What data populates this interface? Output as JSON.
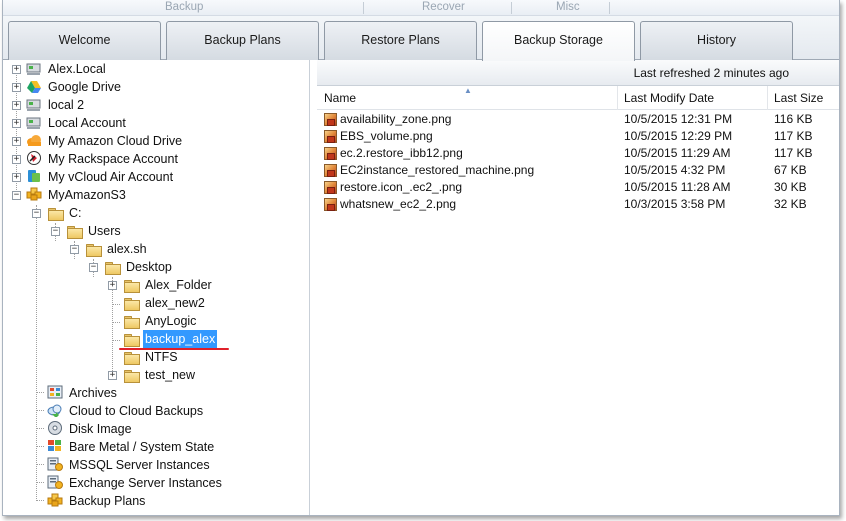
{
  "ribbon": {
    "items": [
      "Backup",
      "Recover",
      "Misc"
    ]
  },
  "tabs": [
    {
      "label": "Welcome",
      "active": false
    },
    {
      "label": "Backup Plans",
      "active": false
    },
    {
      "label": "Restore Plans",
      "active": false
    },
    {
      "label": "Backup Storage",
      "active": true
    },
    {
      "label": "History",
      "active": false
    }
  ],
  "tree": {
    "accounts": [
      {
        "label": "Alex.Local",
        "icon": "local-drive-icon"
      },
      {
        "label": "Google Drive",
        "icon": "google-drive-icon"
      },
      {
        "label": "local 2",
        "icon": "local-drive-icon"
      },
      {
        "label": "Local Account",
        "icon": "local-drive-icon"
      },
      {
        "label": "My Amazon Cloud Drive",
        "icon": "amazon-cloud-drive-icon"
      },
      {
        "label": "My Rackspace Account",
        "icon": "rackspace-icon"
      },
      {
        "label": "My vCloud Air Account",
        "icon": "vcloud-air-icon"
      },
      {
        "label": "MyAmazonS3",
        "icon": "amazon-s3-icon"
      }
    ],
    "folders": {
      "c": "C:",
      "users": "Users",
      "alex_sh": "alex.sh",
      "desktop": "Desktop",
      "children": [
        "Alex_Folder",
        "alex_new2",
        "AnyLogic",
        "backup_alex",
        "NTFS",
        "test_new"
      ],
      "selected": "backup_alex"
    },
    "categories": [
      {
        "label": "Archives",
        "icon": "archives-icon"
      },
      {
        "label": "Cloud to Cloud Backups",
        "icon": "cloud-to-cloud-icon"
      },
      {
        "label": "Disk Image",
        "icon": "disk-image-icon"
      },
      {
        "label": "Bare Metal / System State",
        "icon": "bare-metal-icon"
      },
      {
        "label": "MSSQL Server Instances",
        "icon": "mssql-icon"
      },
      {
        "label": "Exchange Server Instances",
        "icon": "exchange-icon"
      },
      {
        "label": "Backup Plans",
        "icon": "backup-plans-icon"
      }
    ]
  },
  "file_panel": {
    "last_refreshed": "Last refreshed 2 minutes ago",
    "columns": {
      "name": "Name",
      "modified": "Last Modify Date",
      "size": "Last Size"
    },
    "files": [
      {
        "name": "availability_zone.png",
        "modified": "10/5/2015 12:31 PM",
        "size": "116 KB"
      },
      {
        "name": "EBS_volume.png",
        "modified": "10/5/2015 12:29 PM",
        "size": "117 KB"
      },
      {
        "name": "ec.2.restore_ibb12.png",
        "modified": "10/5/2015 11:29 AM",
        "size": "117 KB"
      },
      {
        "name": "EC2instance_restored_machine.png",
        "modified": "10/5/2015 4:32 PM",
        "size": "67 KB"
      },
      {
        "name": "restore.icon_.ec2_.png",
        "modified": "10/5/2015 11:28 AM",
        "size": "30 KB"
      },
      {
        "name": "whatsnew_ec2_2.png",
        "modified": "10/3/2015 3:58 PM",
        "size": "32 KB"
      }
    ]
  },
  "colors": {
    "selection": "#3399ff",
    "annotation_underline": "#e0202a"
  }
}
